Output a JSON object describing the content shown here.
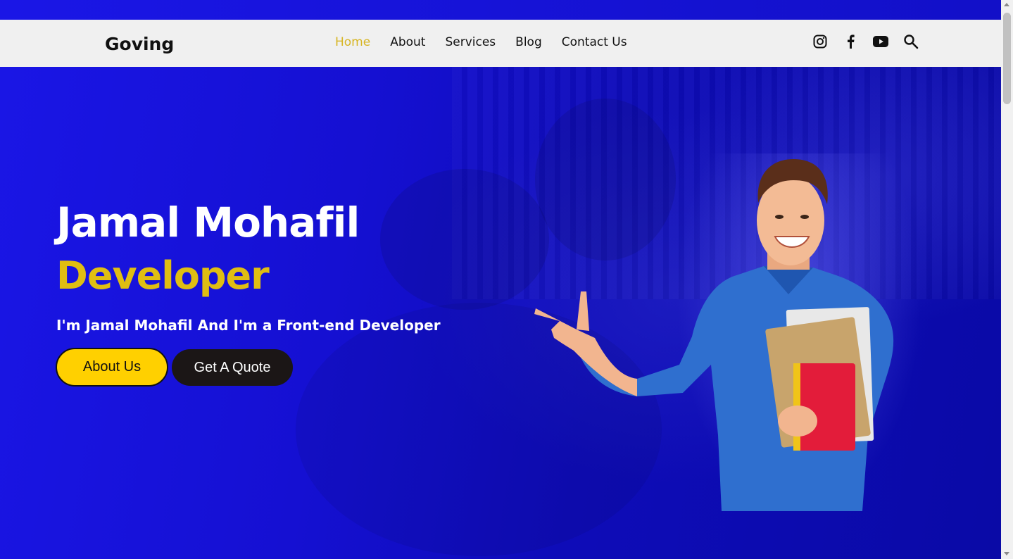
{
  "brand": "Goving",
  "nav": {
    "items": [
      {
        "label": "Home",
        "active": true
      },
      {
        "label": "About"
      },
      {
        "label": "Services"
      },
      {
        "label": "Blog"
      },
      {
        "label": "Contact Us"
      }
    ]
  },
  "social_icons": [
    "instagram-icon",
    "facebook-icon",
    "youtube-icon",
    "search-icon"
  ],
  "hero": {
    "title": "Jamal Mohafil",
    "role": "Developer",
    "subtitle": "I'm Jamal Mohafil And I'm a Front-end Developer",
    "primary_button": "About Us",
    "secondary_button": "Get A Quote"
  },
  "colors": {
    "accent": "#e0be12",
    "hero_bg": "#1410d6",
    "nav_bg": "#f0f0f0",
    "primary_button_bg": "#ffd000",
    "secondary_button_bg": "#1b1616"
  }
}
